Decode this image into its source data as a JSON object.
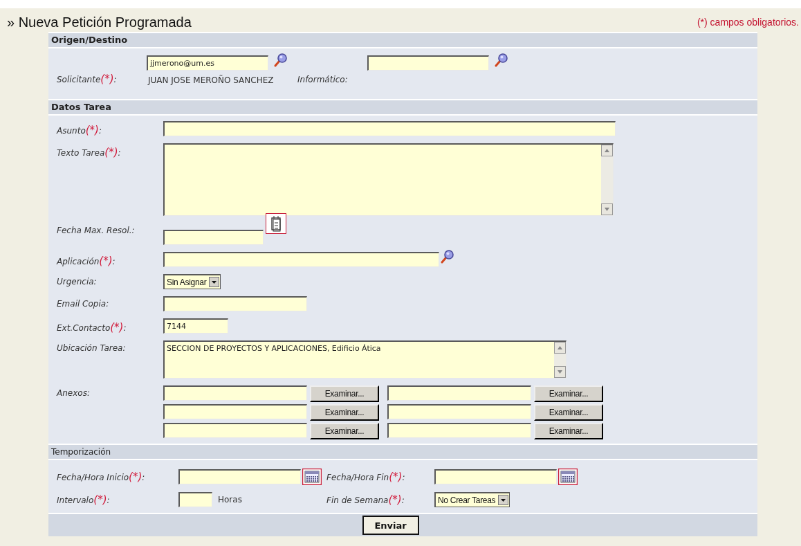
{
  "title": "» Nueva Petición Programada",
  "required_note": "(*) campos obligatorios.",
  "origen": {
    "header": "Origen/Destino",
    "solicitante": {
      "label": "Solicitante",
      "required_mark": "(*)",
      "label_end": ":",
      "value": "jjmerono@um.es",
      "person": "JUAN JOSE MEROÑO SANCHEZ"
    },
    "informatico": {
      "label": "Informático:"
    }
  },
  "tarea": {
    "header": "Datos Tarea",
    "fields": [
      {
        "kind": "text",
        "label": "Asunto",
        "required_mark": "(*)",
        "label_end": ":"
      },
      {
        "kind": "textarea",
        "label": "Texto Tarea",
        "required_mark": "(*)",
        "label_end": ":"
      },
      {
        "kind": "date",
        "label": "Fecha Max. Resol.:"
      },
      {
        "kind": "lookup",
        "label": "Aplicación",
        "required_mark": "(*)",
        "label_end": ":"
      },
      {
        "kind": "select",
        "label": "Urgencia:",
        "value": "Sin Asignar"
      },
      {
        "kind": "text",
        "label": "Email Copia:"
      },
      {
        "kind": "text",
        "label": "Ext.Contacto",
        "required_mark": "(*)",
        "label_end": ":",
        "value": "7144"
      },
      {
        "kind": "textarea",
        "label": "Ubicación Tarea:",
        "value": "SECCION DE PROYECTOS Y APLICACIONES, Edificio Ática"
      },
      {
        "kind": "files",
        "label": "Anexos:",
        "buttons": [
          "Examinar...",
          "Examinar...",
          "Examinar...",
          "Examinar...",
          "Examinar...",
          "Examinar..."
        ]
      }
    ]
  },
  "temporizacion": {
    "header": "Temporización",
    "inicio": {
      "label": "Fecha/Hora Inicio",
      "required_mark": "(*)",
      "label_end": ":"
    },
    "fin": {
      "label": "Fecha/Hora Fin",
      "required_mark": "(*)",
      "label_end": ":"
    },
    "intervalo": {
      "label": "Intervalo",
      "required_mark": "(*)",
      "label_end": ":",
      "unit": "Horas"
    },
    "fin_semana": {
      "label": "Fin de Semana",
      "required_mark": "(*)",
      "label_end": ":",
      "value": "No Crear Tareas"
    }
  },
  "submit": "Enviar"
}
